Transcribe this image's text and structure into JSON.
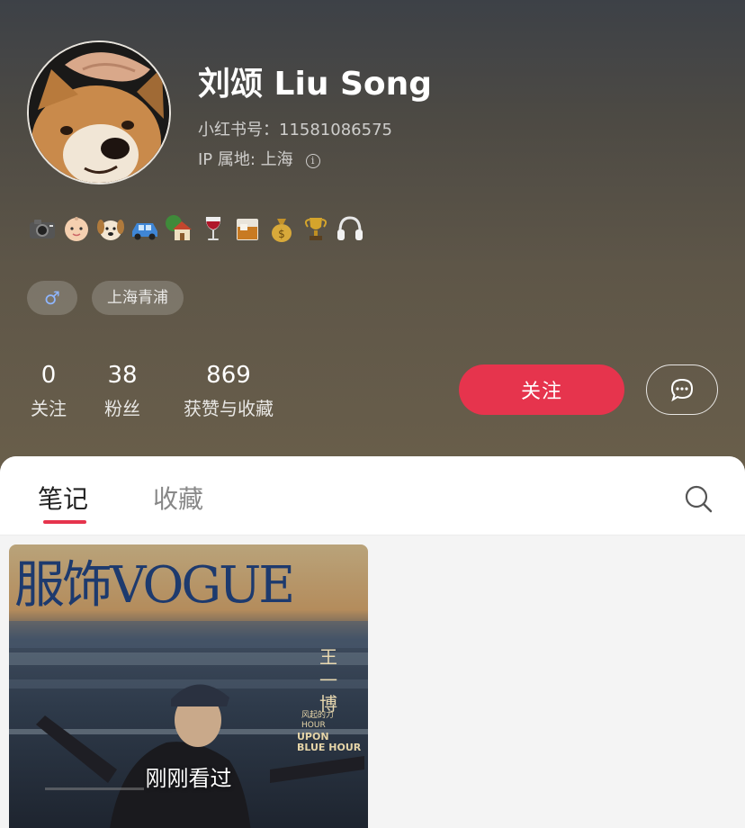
{
  "profile": {
    "name": "刘颂 Liu Song",
    "id_label": "小红书号：11581086575",
    "ip_label": "IP 属地: 上海",
    "info_glyph": "i",
    "bio_emojis": [
      "camera-icon",
      "baby-icon",
      "dog-icon",
      "car-icon",
      "house-icon",
      "wine-glass-icon",
      "whisky-glass-icon",
      "money-bag-icon",
      "trophy-icon",
      "headphones-icon"
    ],
    "tags": {
      "gender_glyph": "♂",
      "location": "上海青浦"
    }
  },
  "stats": [
    {
      "value": "0",
      "label": "关注"
    },
    {
      "value": "38",
      "label": "粉丝"
    },
    {
      "value": "869",
      "label": "获赞与收藏"
    }
  ],
  "actions": {
    "follow_label": "关注",
    "message_icon": "chat-bubble-icon"
  },
  "tabs": [
    {
      "label": "笔记",
      "active": true
    },
    {
      "label": "收藏",
      "active": false
    }
  ],
  "notes": [
    {
      "magazine_title": "服饰VOGUE",
      "cover_side_text": [
        "王",
        "一",
        "博"
      ],
      "cover_small_text": [
        "风起的力",
        "HOUR"
      ],
      "cover_caption": [
        "UPON",
        "BLUE HOUR"
      ],
      "overlay_text": "刚刚看过"
    }
  ],
  "colors": {
    "accent": "#e6344d",
    "header_top": "#3d4147",
    "header_bottom": "#6a5f4b"
  }
}
